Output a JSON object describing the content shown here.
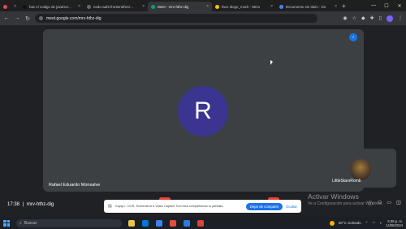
{
  "browser": {
    "tabs": [
      {
        "label": "",
        "color": "#e04b4b",
        "active": false,
        "small": true
      },
      {
        "label": "haz el codigo de java/scr...",
        "color": "#111111",
        "active": false
      },
      {
        "label": "nodo-aahi-frontend/src/...",
        "color": "#6a6a6a",
        "active": false
      },
      {
        "label": "Meet - mrv-hthz-dig",
        "color": "#00a86b",
        "active": true
      },
      {
        "label": "face-idogo_mock - Mmo",
        "color": "#ffc107",
        "active": false
      },
      {
        "label": "Documento sin titulo - Do",
        "color": "#4285f4",
        "active": false
      }
    ],
    "url": "meet.google.com/mrv-hthz-dig"
  },
  "meet": {
    "participant_initial": "R",
    "participant_name": "Rafael Eduardo Monsalve",
    "self_name": "LittleStarsRomb",
    "time": "17:38",
    "separator": "|",
    "meeting_code": "mrv-hthz-dig",
    "share_notice": "Capiyu - OCR, Screenshot & Video Capture Tool está compartiendo tu pantalla.",
    "share_stop_label": "Dejar de compartir",
    "share_hide_label": "Ocultar",
    "watermark_title": "Activar Windows",
    "watermark_sub": "Ve a Configuración para activar Windows."
  },
  "taskbar": {
    "search_placeholder": "Buscar",
    "weather": "28°C  Soleado",
    "time": "5:38 p. m.",
    "date": "14/08/2024"
  },
  "colors": {
    "accent": "#1a73e8",
    "avatar": "#3a3590",
    "tile": "#3c4043"
  }
}
